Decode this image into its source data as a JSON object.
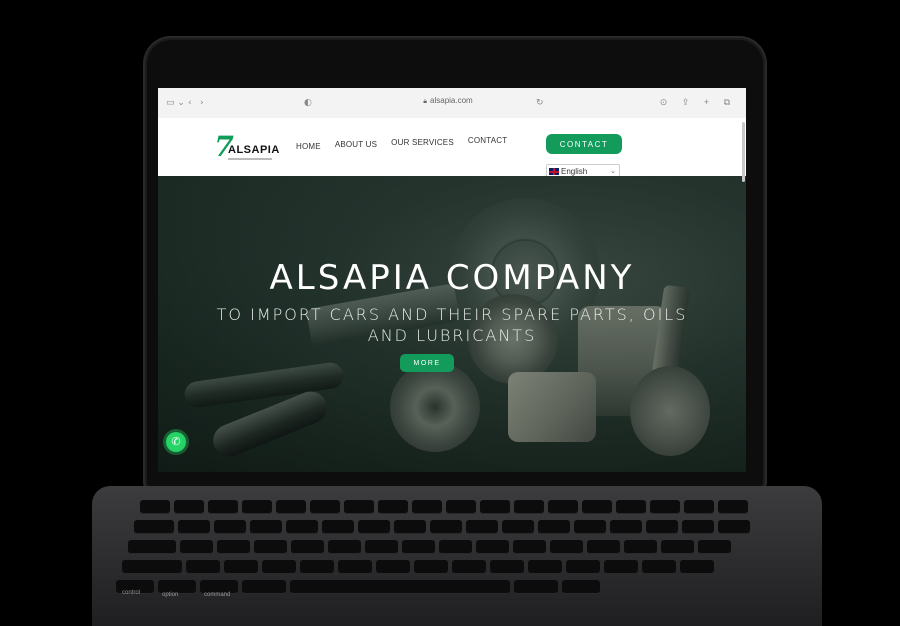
{
  "browser": {
    "url": "alsapia.com",
    "icons": [
      "sidebar-icon",
      "back-icon",
      "forward-icon",
      "shield-icon",
      "lock-icon",
      "reload-icon",
      "download-icon",
      "share-icon",
      "new-tab-icon",
      "tabs-icon"
    ]
  },
  "site": {
    "brand": "ALSAPIA",
    "nav": [
      {
        "label": "HOME"
      },
      {
        "label": "ABOUT US"
      },
      {
        "label": "OUR SERVICES"
      },
      {
        "label": "CONTACT"
      }
    ],
    "contact_button": "CONTACT",
    "language": "English"
  },
  "hero": {
    "title": "ALSAPIA COMPANY",
    "subtitle": "TO IMPORT CARS AND THEIR SPARE PARTS, OILS AND LUBRICANTS",
    "button": "MORE"
  },
  "keyboard": {
    "labels": [
      "control",
      "option",
      "command"
    ]
  },
  "colors": {
    "accent": "#129b5a",
    "whatsapp": "#25d366"
  }
}
